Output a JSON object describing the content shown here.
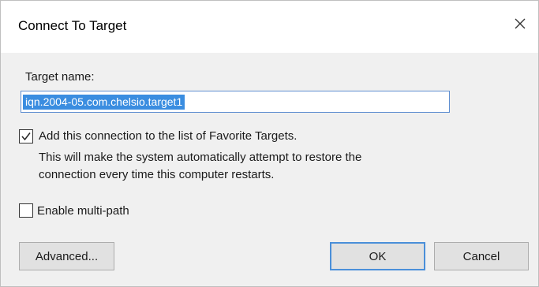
{
  "window": {
    "title": "Connect To Target",
    "close_icon": "close-icon"
  },
  "target_name": {
    "label": "Target name:",
    "value": "iqn.2004-05.com.chelsio.target1",
    "selected": true
  },
  "favorites": {
    "checked": true,
    "label": "Add this connection to the list of Favorite Targets.",
    "description_line1": "This will make the system automatically attempt to restore the",
    "description_line2": "connection every time this computer restarts."
  },
  "multipath": {
    "checked": false,
    "label": "Enable multi-path"
  },
  "buttons": {
    "advanced": "Advanced...",
    "ok": "OK",
    "cancel": "Cancel"
  },
  "colors": {
    "accent": "#3a8de0",
    "dialog_bg": "#f0f0f0",
    "title_bg": "#ffffff"
  }
}
